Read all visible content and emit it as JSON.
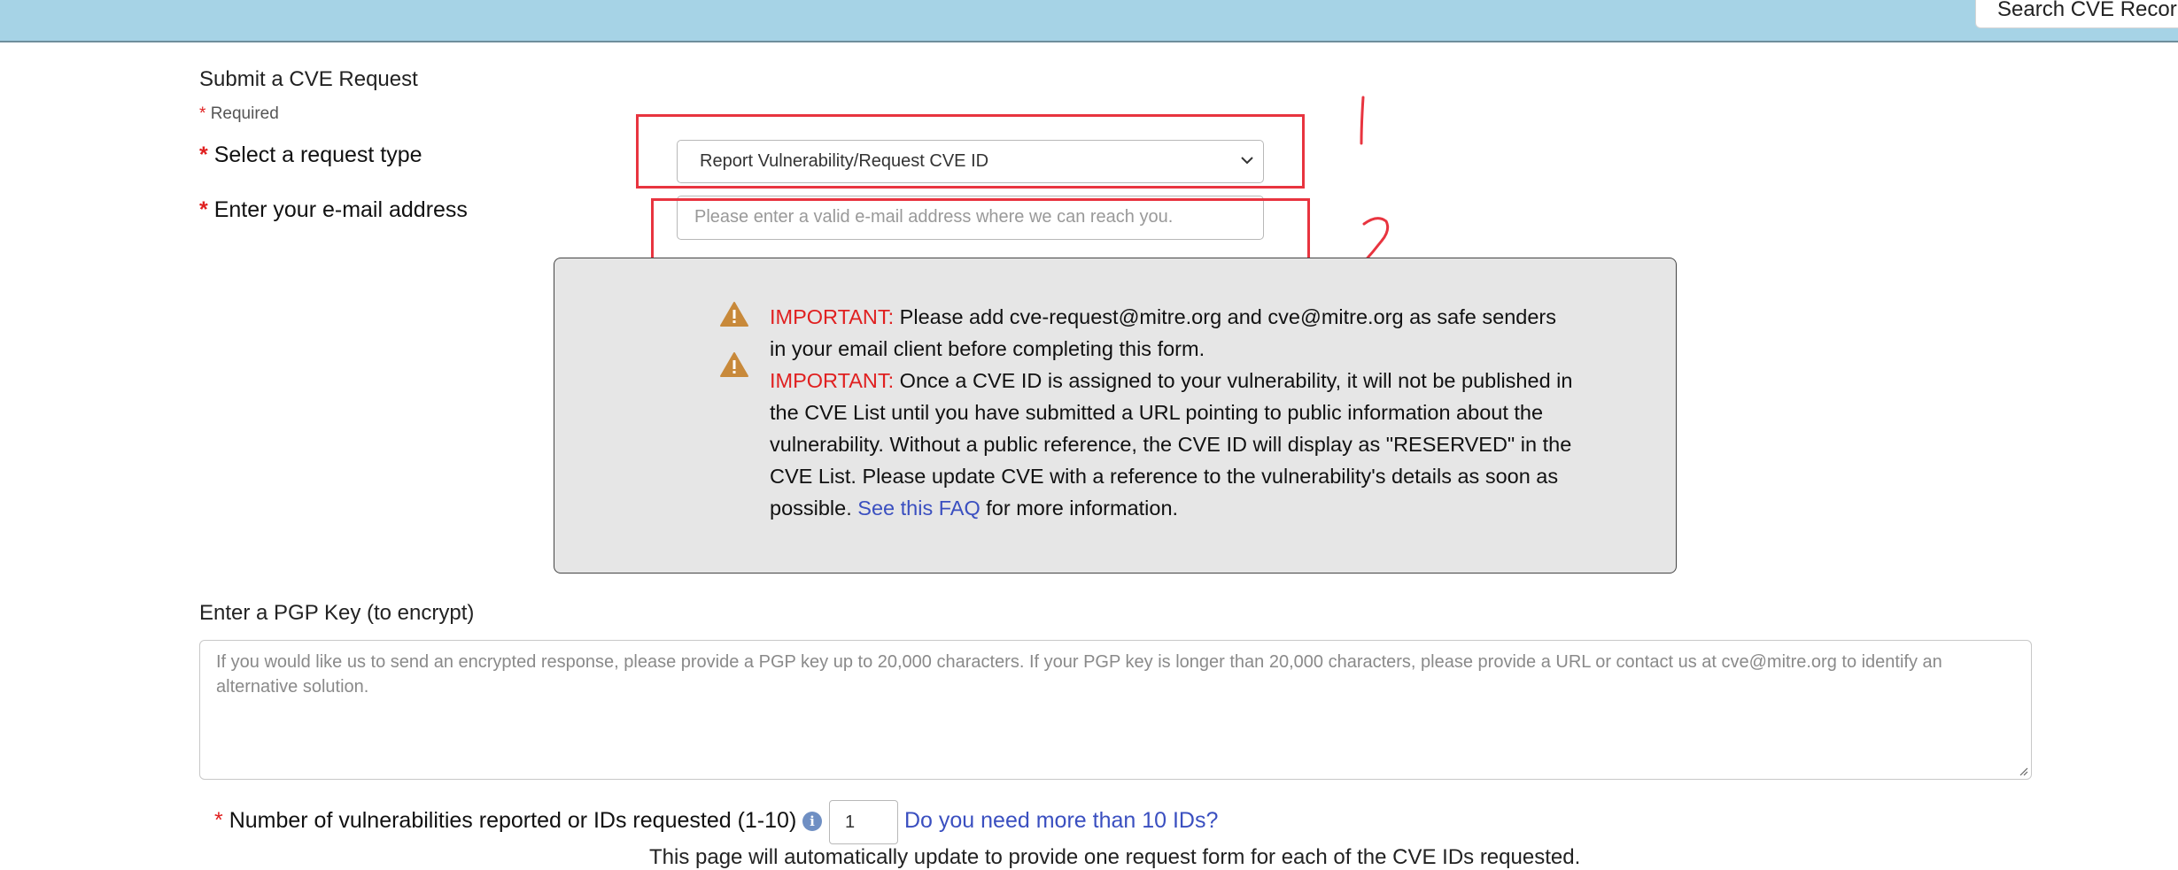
{
  "header": {
    "search_button": "Search CVE Recor"
  },
  "form": {
    "title": "Submit a CVE Request",
    "required_star": "*",
    "required_note": "Required",
    "request_type": {
      "label": "Select a request type",
      "selected": "Report Vulnerability/Request CVE ID"
    },
    "email": {
      "label": "Enter your e-mail address",
      "placeholder": "Please enter a valid e-mail address where we can reach you."
    },
    "notice": {
      "prefix": "IMPORTANT:",
      "line1a": "Please add cve-request@mitre.org and cve@mitre.org as safe senders",
      "line1b": "in your email client before completing this form.",
      "line2a": "Once a CVE ID is assigned to your vulnerability, it will not be published in",
      "line2b": "the CVE List until you have submitted a URL pointing to public information about the",
      "line2c": "vulnerability. Without a public reference, the CVE ID will display as \"RESERVED\" in the",
      "line2d": "CVE List. Please update CVE with a reference to the vulnerability's details as soon as",
      "line2e_pre": "possible.",
      "faq_link": "See this FAQ",
      "line2e_post": "for more information."
    },
    "pgp": {
      "label": "Enter a PGP Key (to encrypt)",
      "placeholder": "If you would like us to send an encrypted response, please provide a PGP key up to 20,000 characters. If your PGP key is longer than 20,000 characters, please provide a URL or contact us at cve@mitre.org to identify an alternative solution."
    },
    "num_vulns": {
      "label": "Number of vulnerabilities reported or IDs requested (1-10)",
      "info_icon": "i",
      "value": "1",
      "more_link": "Do you need more than 10 IDs?"
    },
    "auto_update_note": "This page will automatically update to provide one request form for each of the CVE IDs requested."
  },
  "annotations": {
    "mark_1": "1",
    "mark_2": "2",
    "color": "#e8343f"
  },
  "colors": {
    "header_bg": "#a6d3e6",
    "required_red": "#e02020",
    "link_blue": "#3a4fc0",
    "notice_bg": "#e6e6e6",
    "warning_orange": "#c8893a"
  }
}
